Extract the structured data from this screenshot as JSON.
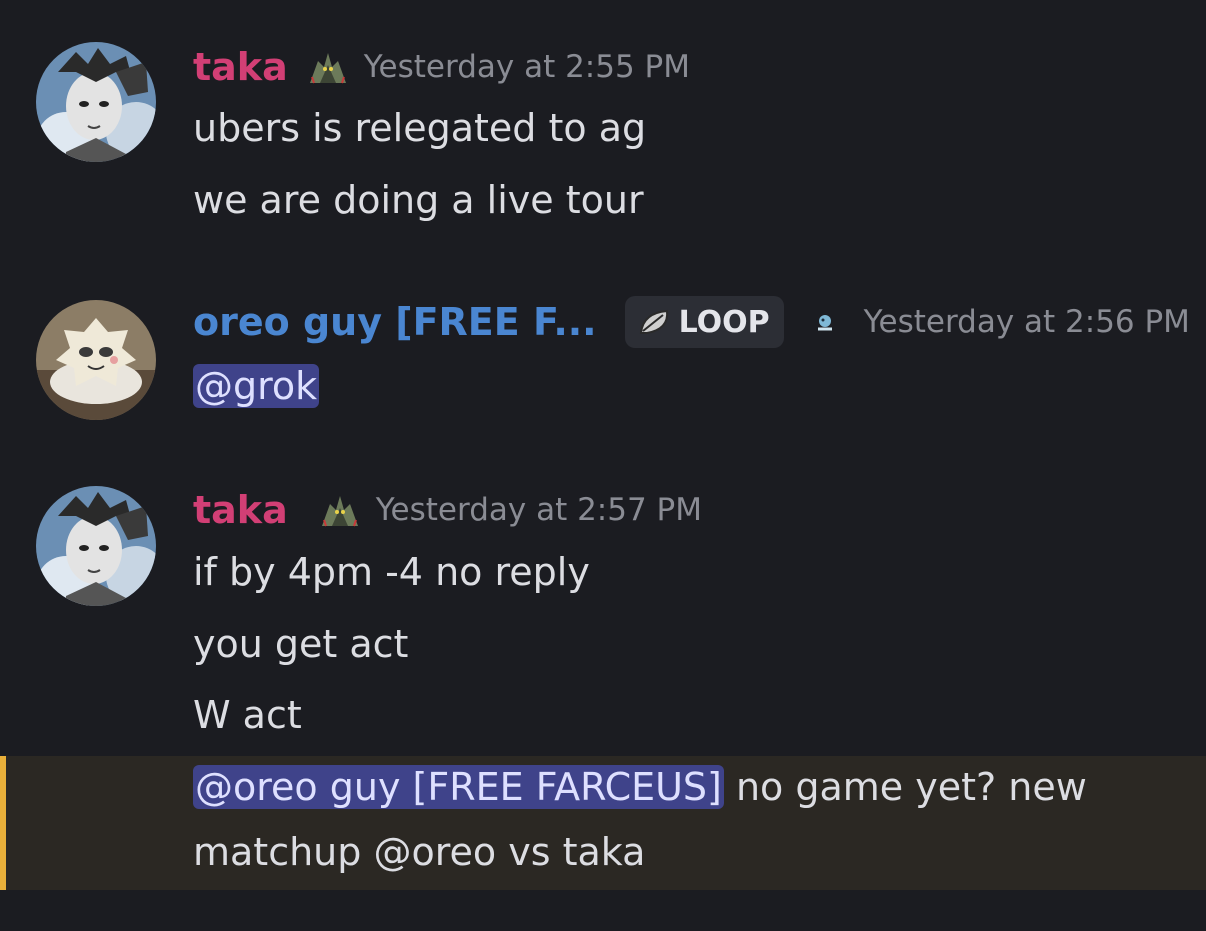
{
  "messages": [
    {
      "author": "taka",
      "timestamp": "Yesterday at 2:55 PM",
      "lines": [
        "ubers is relegated to ag",
        "we are doing a live tour"
      ]
    },
    {
      "author": "oreo guy [FREE F...",
      "tag": "LOOP",
      "timestamp": "Yesterday at 2:56 PM",
      "mention": "@grok"
    },
    {
      "author": "taka",
      "timestamp": "Yesterday at 2:57 PM",
      "lines": [
        "if by 4pm -4 no reply",
        "you get act",
        "W act"
      ],
      "highlighted": {
        "mention": "@oreo guy [FREE FARCEUS]",
        "text_after_mention": " no game yet? new",
        "second_line": "matchup @oreo vs taka"
      }
    }
  ],
  "colors": {
    "background": "#1b1c21",
    "taka_name": "#d23f75",
    "oreo_name": "#4a86d1",
    "mention_bg": "#3f438a",
    "highlight_bg": "#2b2823",
    "highlight_bar": "#e9b03a"
  },
  "icons": {
    "role_icon_taka": "gargoyle-icon",
    "role_icon_oreo": "pokemon-sprite-icon",
    "tag_icon": "leaf-icon"
  }
}
